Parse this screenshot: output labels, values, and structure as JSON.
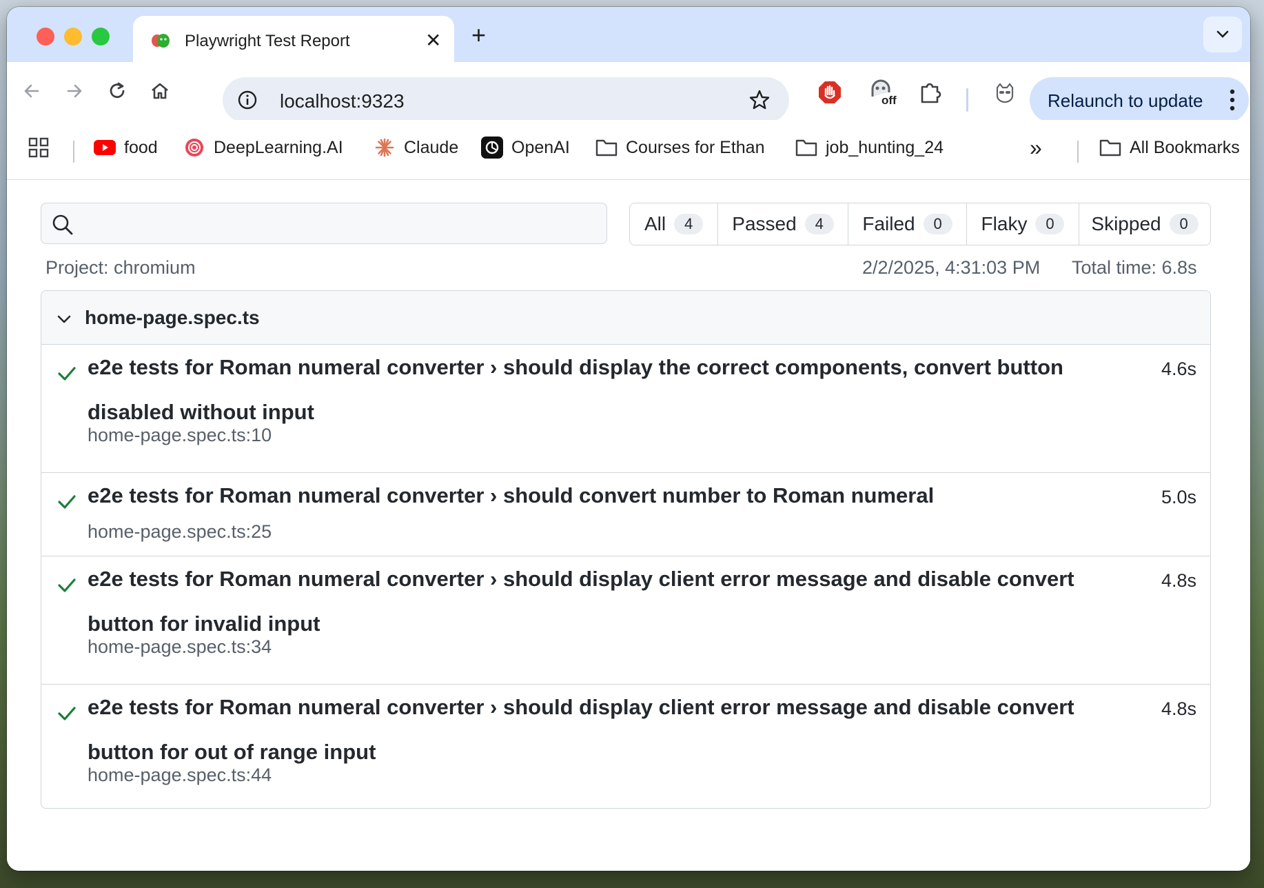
{
  "tab": {
    "title": "Playwright Test Report",
    "close": "✕",
    "new_tab": "+"
  },
  "address_bar": {
    "url": "localhost:9323"
  },
  "toolbar": {
    "relaunch_label": "Relaunch to update",
    "ext_badge": "off"
  },
  "bookmarks": {
    "items": [
      {
        "label": "food",
        "icon": "youtube-icon"
      },
      {
        "label": "DeepLearning.AI",
        "icon": "deeplearning-icon"
      },
      {
        "label": "Claude",
        "icon": "claude-icon"
      },
      {
        "label": "OpenAI",
        "icon": "openai-icon"
      },
      {
        "label": "Courses for Ethan",
        "icon": "folder-icon"
      },
      {
        "label": "job_hunting_24",
        "icon": "folder-icon"
      }
    ],
    "overflow": "»",
    "all_bookmarks": "All Bookmarks"
  },
  "report": {
    "search_placeholder": "",
    "filters": [
      {
        "label": "All",
        "count": "4"
      },
      {
        "label": "Passed",
        "count": "4"
      },
      {
        "label": "Failed",
        "count": "0"
      },
      {
        "label": "Flaky",
        "count": "0"
      },
      {
        "label": "Skipped",
        "count": "0"
      }
    ],
    "project": "Project: chromium",
    "datetime": "2/2/2025, 4:31:03 PM",
    "total_time": "Total time: 6.8s",
    "file": {
      "name": "home-page.spec.ts",
      "tests": [
        {
          "title": "e2e tests for Roman numeral converter › should display the correct components, convert button disabled without input",
          "duration": "4.6s",
          "location": "home-page.spec.ts:10",
          "status": "passed"
        },
        {
          "title": "e2e tests for Roman numeral converter › should convert number to Roman numeral",
          "duration": "5.0s",
          "location": "home-page.spec.ts:25",
          "status": "passed"
        },
        {
          "title": "e2e tests for Roman numeral converter › should display client error message and disable convert button for invalid input",
          "duration": "4.8s",
          "location": "home-page.spec.ts:34",
          "status": "passed"
        },
        {
          "title": "e2e tests for Roman numeral converter › should display client error message and disable convert button for out of range input",
          "duration": "4.8s",
          "location": "home-page.spec.ts:44",
          "status": "passed"
        }
      ]
    }
  },
  "colors": {
    "pass": "#1a7f37",
    "tabstrip": "#d3e3fd",
    "muted_text": "#57606a"
  }
}
